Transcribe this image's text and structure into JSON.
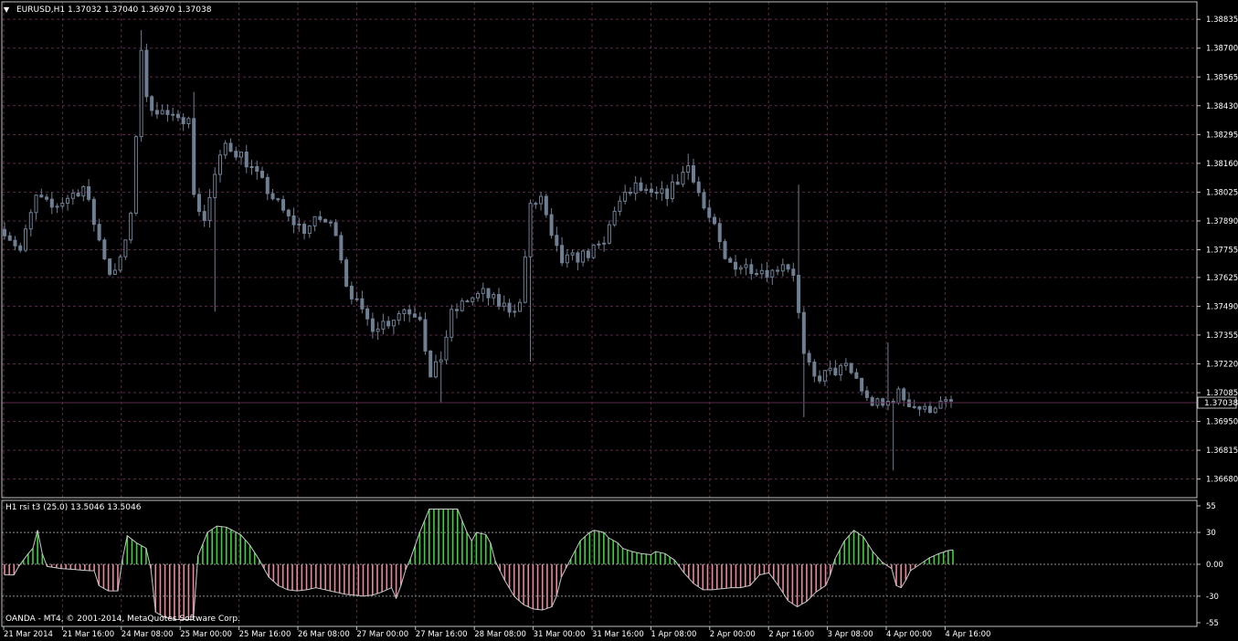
{
  "main_header": {
    "menu_glyph": "▼",
    "text": "EURUSD,H1  1.37032 1.37040 1.36970 1.37038"
  },
  "sub_header": {
    "text": "H1 rsi t3 (25.0) 13.5046 13.5046"
  },
  "copyright": "OANDA - MT4, © 2001-2014, MetaQuotes Software Corp.",
  "colors": {
    "background": "#000000",
    "frame": "#c0c0c0",
    "grid": "#5a2a4a",
    "candle": "#6f7f93",
    "price_line": "#5a2a4a",
    "rsi_line": "#c8c8c8",
    "rsi_positive": "#3fcf3f",
    "rsi_negative": "#e8889a",
    "level_line": "#909090",
    "text": "#ffffff"
  },
  "chart_data": [
    {
      "type": "candlestick",
      "symbol": "EURUSD",
      "timeframe": "H1",
      "last_price_label": "1.37038",
      "ylim": [
        1.3661,
        1.389
      ],
      "y_ticks": [
        "1.38835",
        "1.38700",
        "1.38565",
        "1.38430",
        "1.38295",
        "1.38160",
        "1.38025",
        "1.37890",
        "1.37755",
        "1.37625",
        "1.37490",
        "1.37355",
        "1.37220",
        "1.37085",
        "1.36950",
        "1.36815",
        "1.36680"
      ],
      "grid": true,
      "close_path": [
        [
          0,
          1.3785
        ],
        [
          3,
          1.3775
        ],
        [
          6,
          1.38
        ],
        [
          9,
          1.3795
        ],
        [
          12,
          1.38
        ],
        [
          15,
          1.3805
        ],
        [
          18,
          1.378
        ],
        [
          20,
          1.3765
        ],
        [
          22,
          1.377
        ],
        [
          24,
          1.379
        ],
        [
          25,
          1.383
        ],
        [
          26,
          1.387
        ],
        [
          27,
          1.3845
        ],
        [
          30,
          1.384
        ],
        [
          33,
          1.3835
        ],
        [
          35,
          1.384
        ],
        [
          36,
          1.38
        ],
        [
          38,
          1.379
        ],
        [
          40,
          1.381
        ],
        [
          42,
          1.3825
        ],
        [
          45,
          1.382
        ],
        [
          48,
          1.381
        ],
        [
          51,
          1.38
        ],
        [
          54,
          1.379
        ],
        [
          57,
          1.3785
        ],
        [
          60,
          1.379
        ],
        [
          63,
          1.3785
        ],
        [
          65,
          1.376
        ],
        [
          68,
          1.3745
        ],
        [
          70,
          1.374
        ],
        [
          73,
          1.3742
        ],
        [
          76,
          1.3748
        ],
        [
          79,
          1.3745
        ],
        [
          81,
          1.3715
        ],
        [
          83,
          1.3725
        ],
        [
          85,
          1.3745
        ],
        [
          88,
          1.3752
        ],
        [
          91,
          1.3755
        ],
        [
          94,
          1.375
        ],
        [
          96,
          1.3748
        ],
        [
          98,
          1.375
        ],
        [
          100,
          1.3795
        ],
        [
          102,
          1.38
        ],
        [
          104,
          1.378
        ],
        [
          106,
          1.377
        ],
        [
          109,
          1.3772
        ],
        [
          112,
          1.3775
        ],
        [
          114,
          1.3778
        ],
        [
          116,
          1.3795
        ],
        [
          118,
          1.38
        ],
        [
          120,
          1.3805
        ],
        [
          123,
          1.38
        ],
        [
          126,
          1.3802
        ],
        [
          128,
          1.3808
        ],
        [
          130,
          1.3815
        ],
        [
          131,
          1.381
        ],
        [
          133,
          1.3795
        ],
        [
          135,
          1.3785
        ],
        [
          137,
          1.377
        ],
        [
          140,
          1.3768
        ],
        [
          143,
          1.3767
        ],
        [
          146,
          1.3765
        ],
        [
          148,
          1.377
        ],
        [
          150,
          1.3765
        ],
        [
          151,
          1.3745
        ],
        [
          152,
          1.3725
        ],
        [
          154,
          1.3715
        ],
        [
          157,
          1.3718
        ],
        [
          160,
          1.372
        ],
        [
          162,
          1.3715
        ],
        [
          164,
          1.3705
        ],
        [
          167,
          1.3702
        ],
        [
          170,
          1.3708
        ],
        [
          172,
          1.3704
        ],
        [
          175,
          1.37
        ],
        [
          177,
          1.3703
        ],
        [
          179,
          1.3703
        ],
        [
          180,
          1.37038
        ]
      ],
      "notable_wicks": [
        {
          "bar": 26,
          "high": 1.38785
        },
        {
          "bar": 40,
          "low": 1.37465
        },
        {
          "bar": 36,
          "high": 1.38495
        },
        {
          "bar": 83,
          "low": 1.3704
        },
        {
          "bar": 100,
          "low": 1.3723
        },
        {
          "bar": 130,
          "high": 1.38205
        },
        {
          "bar": 151,
          "high": 1.3806
        },
        {
          "bar": 152,
          "low": 1.3697
        },
        {
          "bar": 169,
          "low": 1.3672
        },
        {
          "bar": 168,
          "high": 1.3732
        }
      ],
      "bar_count": 181
    },
    {
      "type": "bar",
      "name": "rsi t3",
      "ylim": [
        -55,
        55
      ],
      "y_ticks": [
        "55",
        "30",
        "0.00",
        "-30",
        "-55"
      ],
      "levels": [
        30,
        0,
        -30
      ],
      "path": [
        [
          0,
          -10
        ],
        [
          2,
          -10
        ],
        [
          3,
          -2
        ],
        [
          4,
          4
        ],
        [
          5,
          10
        ],
        [
          6,
          15
        ],
        [
          7,
          32
        ],
        [
          8,
          10
        ],
        [
          9,
          -2
        ],
        [
          12,
          -4
        ],
        [
          15,
          -5
        ],
        [
          18,
          -6
        ],
        [
          19,
          -6
        ],
        [
          20,
          -20
        ],
        [
          22,
          -25
        ],
        [
          24,
          -25
        ],
        [
          25,
          5
        ],
        [
          26,
          27
        ],
        [
          28,
          20
        ],
        [
          30,
          15
        ],
        [
          31,
          -4
        ],
        [
          32,
          -45
        ],
        [
          34,
          -50
        ],
        [
          36,
          -52
        ],
        [
          40,
          -52
        ],
        [
          41,
          8
        ],
        [
          43,
          30
        ],
        [
          45,
          36
        ],
        [
          47,
          35
        ],
        [
          50,
          28
        ],
        [
          52,
          18
        ],
        [
          54,
          4
        ],
        [
          56,
          -12
        ],
        [
          58,
          -20
        ],
        [
          60,
          -24
        ],
        [
          62,
          -25
        ],
        [
          64,
          -24
        ],
        [
          66,
          -22
        ],
        [
          68,
          -24
        ],
        [
          70,
          -26
        ],
        [
          72,
          -28
        ],
        [
          74,
          -29
        ],
        [
          76,
          -30
        ],
        [
          78,
          -29
        ],
        [
          80,
          -26
        ],
        [
          82,
          -22
        ],
        [
          83,
          -32
        ],
        [
          84,
          -20
        ],
        [
          85,
          -5
        ],
        [
          86,
          5
        ],
        [
          88,
          30
        ],
        [
          90,
          52
        ],
        [
          92,
          52
        ],
        [
          96,
          52
        ],
        [
          98,
          30
        ],
        [
          99,
          22
        ],
        [
          100,
          30
        ],
        [
          102,
          28
        ],
        [
          103,
          20
        ],
        [
          104,
          3
        ],
        [
          106,
          -15
        ],
        [
          108,
          -30
        ],
        [
          110,
          -38
        ],
        [
          112,
          -42
        ],
        [
          114,
          -43
        ],
        [
          116,
          -40
        ],
        [
          117,
          -30
        ],
        [
          118,
          -12
        ],
        [
          120,
          5
        ],
        [
          122,
          22
        ],
        [
          124,
          30
        ],
        [
          125,
          32
        ],
        [
          127,
          30
        ],
        [
          128,
          25
        ],
        [
          130,
          20
        ],
        [
          131,
          15
        ],
        [
          133,
          12
        ],
        [
          135,
          10
        ],
        [
          137,
          9
        ],
        [
          138,
          12
        ],
        [
          140,
          10
        ],
        [
          142,
          4
        ],
        [
          144,
          -8
        ],
        [
          146,
          -18
        ],
        [
          148,
          -24
        ],
        [
          150,
          -24
        ],
        [
          152,
          -23
        ],
        [
          154,
          -22
        ],
        [
          156,
          -22
        ],
        [
          158,
          -20
        ],
        [
          160,
          -10
        ],
        [
          162,
          -8
        ],
        [
          164,
          -20
        ],
        [
          166,
          -34
        ],
        [
          168,
          -40
        ],
        [
          170,
          -35
        ],
        [
          172,
          -26
        ],
        [
          174,
          -20
        ],
        [
          175,
          -10
        ],
        [
          176,
          5
        ],
        [
          178,
          22
        ],
        [
          180,
          32
        ],
        [
          182,
          26
        ],
        [
          184,
          12
        ],
        [
          186,
          2
        ],
        [
          188,
          -4
        ],
        [
          189,
          -20
        ],
        [
          190,
          -22
        ],
        [
          191,
          -15
        ],
        [
          192,
          -6
        ],
        [
          194,
          0
        ],
        [
          196,
          6
        ],
        [
          198,
          10
        ],
        [
          200,
          13
        ],
        [
          201,
          13.5
        ]
      ],
      "bar_count": 202
    }
  ],
  "time_axis": {
    "labels": [
      "21 Mar 2014",
      "21 Mar 16:00",
      "24 Mar 08:00",
      "25 Mar 00:00",
      "25 Mar 16:00",
      "26 Mar 08:00",
      "27 Mar 00:00",
      "27 Mar 16:00",
      "28 Mar 08:00",
      "31 Mar 00:00",
      "31 Mar 16:00",
      "1 Apr 08:00",
      "2 Apr 00:00",
      "2 Apr 16:00",
      "3 Apr 08:00",
      "4 Apr 00:00",
      "4 Apr 16:00"
    ]
  }
}
